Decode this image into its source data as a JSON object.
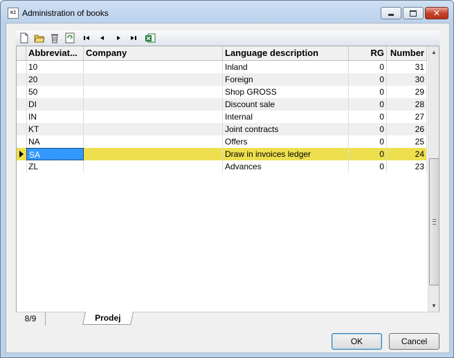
{
  "window": {
    "title": "Administration of books",
    "icon_text": "KZ",
    "controls": [
      "minimize-icon",
      "maximize-icon",
      "close-icon"
    ]
  },
  "toolbar": {
    "icons": [
      "new-document-icon",
      "open-folder-icon",
      "delete-icon",
      "refresh-icon",
      "first-record-icon",
      "previous-record-icon",
      "next-record-icon",
      "last-record-icon",
      "excel-export-icon"
    ]
  },
  "grid": {
    "columns": [
      "Abbreviat...",
      "Company",
      "Language description",
      "RG",
      "Number"
    ],
    "rows": [
      {
        "abbr": "10",
        "company": "",
        "desc": "Inland",
        "rg": "0",
        "number": "31"
      },
      {
        "abbr": "20",
        "company": "",
        "desc": "Foreign",
        "rg": "0",
        "number": "30"
      },
      {
        "abbr": "50",
        "company": "",
        "desc": "Shop GROSS",
        "rg": "0",
        "number": "29"
      },
      {
        "abbr": "DI",
        "company": "",
        "desc": "Discount sale",
        "rg": "0",
        "number": "28"
      },
      {
        "abbr": "IN",
        "company": "",
        "desc": "Internal",
        "rg": "0",
        "number": "27"
      },
      {
        "abbr": "KT",
        "company": "",
        "desc": "Joint contracts",
        "rg": "0",
        "number": "26"
      },
      {
        "abbr": "NA",
        "company": "",
        "desc": "Offers",
        "rg": "0",
        "number": "25"
      },
      {
        "abbr": "SA",
        "company": "",
        "desc": "Draw in invoices ledger",
        "rg": "0",
        "number": "24"
      },
      {
        "abbr": "ZL",
        "company": "",
        "desc": "Advances",
        "rg": "0",
        "number": "23"
      }
    ],
    "selected_row": 7,
    "selected_color": "#eedf4f"
  },
  "status": {
    "record": "8/9",
    "tab": "Prodej"
  },
  "buttons": {
    "ok": "OK",
    "cancel": "Cancel"
  }
}
